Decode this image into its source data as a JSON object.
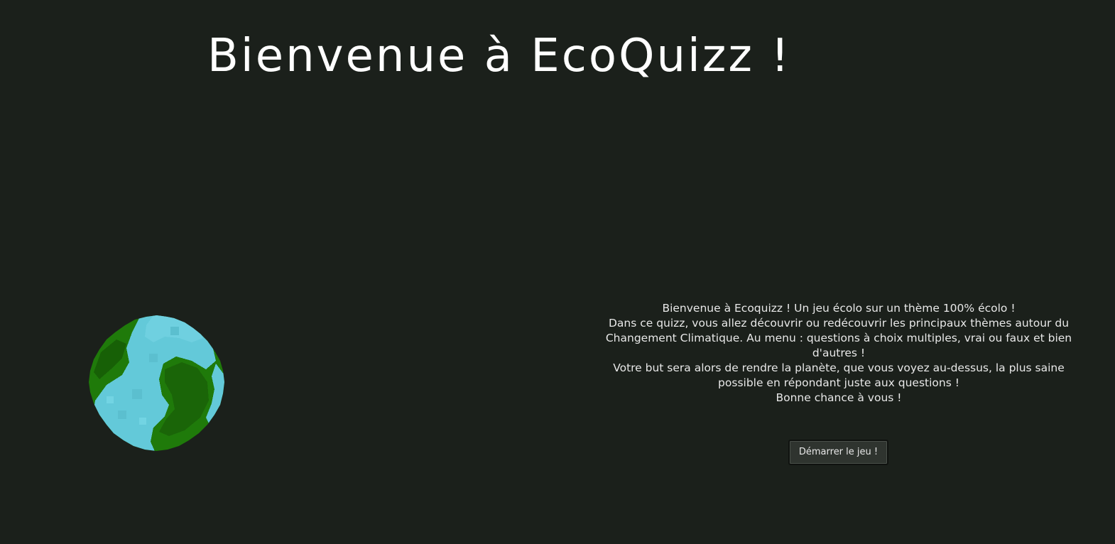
{
  "title": "Bienvenue à EcoQuizz !",
  "intro": {
    "lines": [
      "Bienvenue à Ecoquizz ! Un jeu écolo sur un thème 100% écolo !",
      "Dans ce quizz, vous allez découvrir ou redécouvrir les principaux thèmes autour du Changement Climatique. Au menu : questions à choix multiples, vrai ou faux et bien d'autres !",
      "Votre but sera alors de rendre la planète, que vous voyez au-dessus, la plus saine possible en répondant juste aux questions !",
      "Bonne chance à vous !"
    ]
  },
  "start_button": {
    "label": "Démarrer le jeu !"
  },
  "planet": {
    "icon": "pixel-earth-icon",
    "land_color": "#1f7a0a",
    "water_color": "#63c9d9"
  },
  "colors": {
    "background": "#1b201b",
    "text": "#ffffff",
    "button_bg": "#2f342f"
  }
}
